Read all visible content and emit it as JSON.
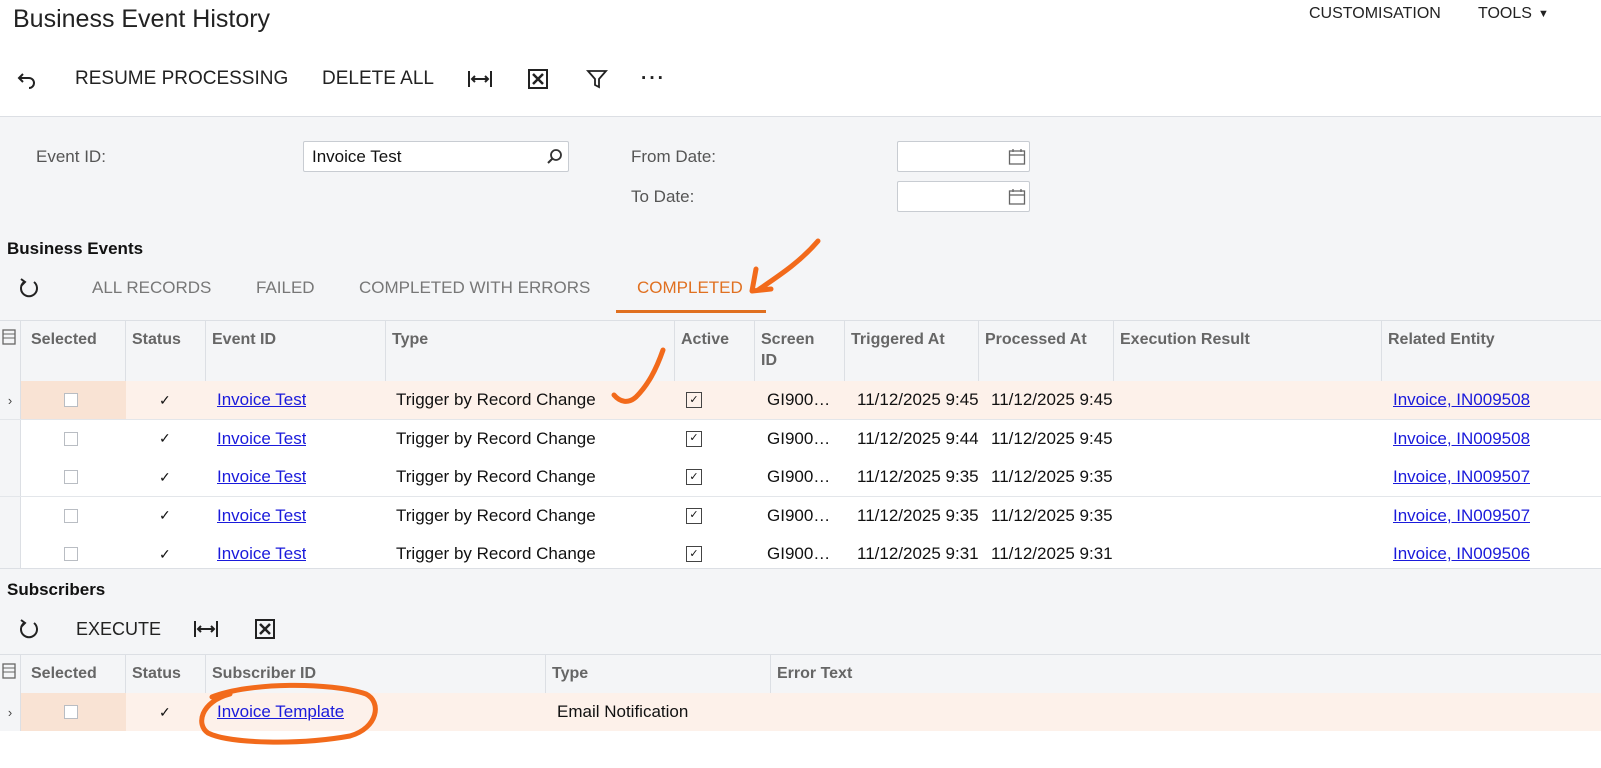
{
  "page": {
    "title": "Business Event History"
  },
  "topmenu": {
    "customisation": "CUSTOMISATION",
    "tools": "TOOLS"
  },
  "toolbar": {
    "resume": "RESUME PROCESSING",
    "delete_all": "DELETE ALL",
    "more": "···"
  },
  "filters": {
    "event_id_label": "Event ID:",
    "event_id_value": "Invoice Test",
    "from_date_label": "From Date:",
    "to_date_label": "To Date:",
    "from_date_value": "",
    "to_date_value": ""
  },
  "business_events": {
    "title": "Business Events",
    "tabs": [
      "ALL RECORDS",
      "FAILED",
      "COMPLETED WITH ERRORS",
      "COMPLETED"
    ],
    "active_tab": "COMPLETED",
    "columns": {
      "selected": "Selected",
      "status": "Status",
      "event_id": "Event ID",
      "type": "Type",
      "active": "Active",
      "screen_id_1": "Screen",
      "screen_id_2": "ID",
      "triggered_at": "Triggered At",
      "processed_at": "Processed At",
      "execution_result": "Execution Result",
      "related_entity": "Related Entity"
    },
    "rows": [
      {
        "event_id": "Invoice Test",
        "type": "Trigger by Record Change",
        "screen_id": "GI900…",
        "triggered_at": "11/12/2025 9:45",
        "processed_at": "11/12/2025 9:45",
        "related_entity": "Invoice, IN009508"
      },
      {
        "event_id": "Invoice Test",
        "type": "Trigger by Record Change",
        "screen_id": "GI900…",
        "triggered_at": "11/12/2025 9:44",
        "processed_at": "11/12/2025 9:45",
        "related_entity": "Invoice, IN009508"
      },
      {
        "event_id": "Invoice Test",
        "type": "Trigger by Record Change",
        "screen_id": "GI900…",
        "triggered_at": "11/12/2025 9:35",
        "processed_at": "11/12/2025 9:35",
        "related_entity": "Invoice, IN009507"
      },
      {
        "event_id": "Invoice Test",
        "type": "Trigger by Record Change",
        "screen_id": "GI900…",
        "triggered_at": "11/12/2025 9:35",
        "processed_at": "11/12/2025 9:35",
        "related_entity": "Invoice, IN009507"
      },
      {
        "event_id": "Invoice Test",
        "type": "Trigger by Record Change",
        "screen_id": "GI900…",
        "triggered_at": "11/12/2025 9:31",
        "processed_at": "11/12/2025 9:31",
        "related_entity": "Invoice, IN009506"
      }
    ]
  },
  "subscribers": {
    "title": "Subscribers",
    "execute": "EXECUTE",
    "columns": {
      "selected": "Selected",
      "status": "Status",
      "subscriber_id": "Subscriber ID",
      "type": "Type",
      "error_text": "Error Text"
    },
    "rows": [
      {
        "subscriber_id": "Invoice Template",
        "type": "Email Notification",
        "error_text": ""
      }
    ]
  },
  "colors": {
    "accent": "#e07020",
    "link": "#1a1adb",
    "annotation": "#f26a1b",
    "row_selected": "#fdf1ea"
  }
}
